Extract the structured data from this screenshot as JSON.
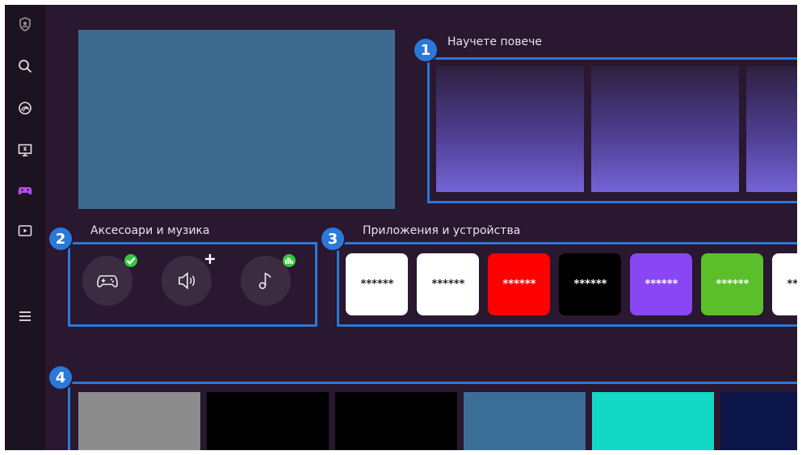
{
  "sidebar": {
    "items": [
      {
        "name": "profile-icon"
      },
      {
        "name": "search-icon"
      },
      {
        "name": "ambient-icon"
      },
      {
        "name": "media-icon"
      },
      {
        "name": "game-icon"
      },
      {
        "name": "source-icon"
      },
      {
        "name": "menu-icon"
      }
    ]
  },
  "sections": {
    "learn_more": {
      "badge": "1",
      "label": "Научете повече"
    },
    "accessories": {
      "badge": "2",
      "label": "Аксесоари и музика"
    },
    "apps": {
      "badge": "3",
      "label": "Приложения и устройства",
      "tiles": [
        {
          "text": "******",
          "bg": "#ffffff",
          "fg": "#222222"
        },
        {
          "text": "******",
          "bg": "#ffffff",
          "fg": "#222222"
        },
        {
          "text": "******",
          "bg": "#ff0000",
          "fg": "#ffffff"
        },
        {
          "text": "******",
          "bg": "#000000",
          "fg": "#ffffff"
        },
        {
          "text": "******",
          "bg": "#8a45f5",
          "fg": "#ffffff"
        },
        {
          "text": "******",
          "bg": "#5bbf2b",
          "fg": "#ffffff"
        },
        {
          "text": "******",
          "bg": "#ffffff",
          "fg": "#222222"
        }
      ]
    },
    "bottom": {
      "badge": "4",
      "tiles": [
        {
          "bg": "#8c8c8c"
        },
        {
          "bg": "#000000"
        },
        {
          "bg": "#000000"
        },
        {
          "bg": "#3b6e96"
        },
        {
          "bg": "#13d8c6"
        },
        {
          "bg": "#0c1547"
        }
      ]
    }
  },
  "colors": {
    "accent": "#2b78d8",
    "background": "#2a1730",
    "hero": "#3d6b8f",
    "check_badge": "#34c83d",
    "game_icon": "#b44cf0"
  }
}
